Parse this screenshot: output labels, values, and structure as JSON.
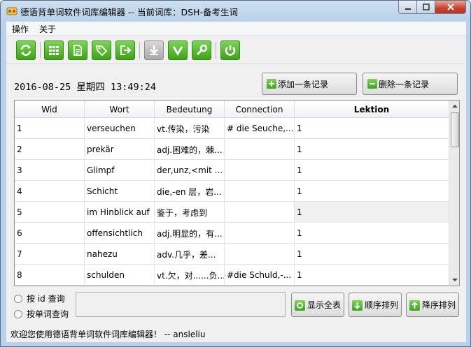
{
  "window": {
    "title": "德语背单词软件词库编辑器 -- 当前词库：DSH-备考生词"
  },
  "menu": {
    "items": [
      {
        "label": "操作"
      },
      {
        "label": "关于"
      }
    ]
  },
  "toolbar": {
    "buttons": [
      {
        "icon": "refresh-icon"
      },
      {
        "icon": "grid-icon"
      },
      {
        "icon": "document-icon"
      },
      {
        "icon": "tags-icon"
      },
      {
        "icon": "export-icon"
      },
      {
        "icon": "download-icon"
      },
      {
        "icon": "check-v-icon"
      },
      {
        "icon": "wrench-icon"
      },
      {
        "icon": "power-icon"
      }
    ]
  },
  "datetime": "2016-08-25 星期四 13:49:24",
  "actions": {
    "add_label": "添加一条记录",
    "delete_label": "删除一条记录"
  },
  "table": {
    "columns": [
      "Wid",
      "Wort",
      "Bedeutung",
      "Connection",
      "Lektion"
    ],
    "rows": [
      {
        "wid": "1",
        "wort": "verseuchen",
        "bedeutung": "vt.传染，污染",
        "connection": "# die Seuche,...",
        "lektion": "1"
      },
      {
        "wid": "2",
        "wort": "prekär",
        "bedeutung": "adj.困难的，棘...",
        "connection": "",
        "lektion": "1"
      },
      {
        "wid": "3",
        "wort": "Glimpf",
        "bedeutung": "der,unz,<mit ...",
        "connection": "",
        "lektion": "1"
      },
      {
        "wid": "4",
        "wort": "Schicht",
        "bedeutung": "die,-en 层，岩...",
        "connection": "",
        "lektion": "1"
      },
      {
        "wid": "5",
        "wort": "im Hinblick auf",
        "bedeutung": "鉴于，考虑到",
        "connection": "",
        "lektion": "1"
      },
      {
        "wid": "6",
        "wort": "offensichtlich",
        "bedeutung": "adj.明显的，有...",
        "connection": "",
        "lektion": "1"
      },
      {
        "wid": "7",
        "wort": "nahezu",
        "bedeutung": "adv.几乎，差...",
        "connection": "",
        "lektion": "1"
      },
      {
        "wid": "8",
        "wort": "schulden",
        "bedeutung": "vt.欠，对......负...",
        "connection": "#die Schuld,-...",
        "lektion": "1"
      }
    ]
  },
  "search": {
    "option_id": "按 id 查询",
    "option_word": "按单词查询",
    "value": ""
  },
  "bottom_buttons": {
    "show_all": "显示全表",
    "sort_asc": "顺序排列",
    "sort_desc": "降序排列"
  },
  "status": "欢迎您使用德语背单词软件词库编辑器！ -- ansleliu",
  "colors": {
    "accent_green": "#3ea317",
    "title_bg": "#b9d1ea",
    "close_red": "#c7402d"
  }
}
